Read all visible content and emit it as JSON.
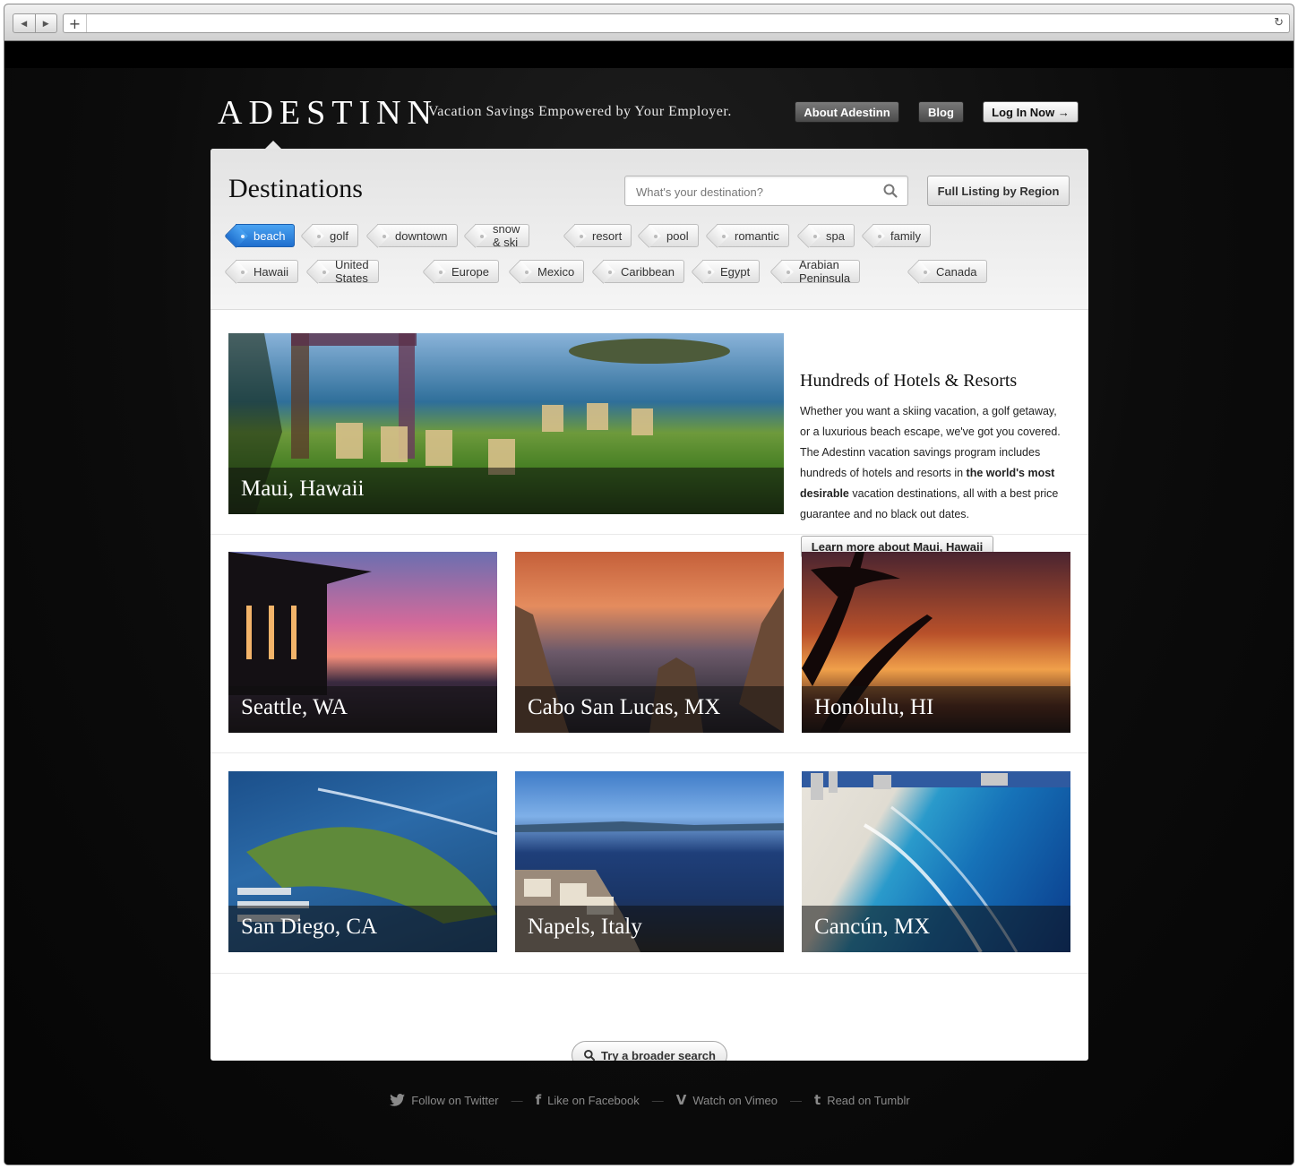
{
  "browser": {
    "back_glyph": "◀",
    "forward_glyph": "▶",
    "new_tab_glyph": "+",
    "reload_glyph": "↻",
    "address": ""
  },
  "header": {
    "logo": "ADESTINN",
    "tagline": "Vacation Savings Empowered by Your Employer.",
    "about_label": "About Adestinn",
    "blog_label": "Blog",
    "login_label": "Log In Now →"
  },
  "destinations": {
    "title": "Destinations",
    "search_placeholder": "What's your destination?",
    "full_listing_label": "Full Listing by Region",
    "tags_row1": [
      "beach",
      "golf",
      "downtown",
      "snow & ski",
      "resort",
      "pool",
      "romantic",
      "spa",
      "family"
    ],
    "tags_row2": [
      "Hawaii",
      "United States",
      "Europe",
      "Mexico",
      "Caribbean",
      "Egypt",
      "Arabian Peninsula",
      "Canada"
    ],
    "active_tag": "beach"
  },
  "featured": {
    "caption": "Maui, Hawaii",
    "heading": "Hundreds of Hotels & Resorts",
    "desc_1": "Whether you want a skiing vacation, a golf getaway, or a luxurious beach escape, we've got you covered. The Adestinn vacation savings program includes hundreds of hotels and resorts in ",
    "desc_bold": "the world's most desirable",
    "desc_2": " vacation destinations, all with a best price guarantee and no black out dates.",
    "learn_label": "Learn more about Maui, Hawaii"
  },
  "grid": [
    "Seattle, WA",
    "Cabo San Lucas, MX",
    "Honolulu, HI",
    "San Diego, CA",
    "Napels, Italy",
    "Cancún, MX"
  ],
  "broader_label": "Try a broader search",
  "footer": {
    "twitter": "Follow on Twitter",
    "facebook": "Like on Facebook",
    "vimeo": "Watch on Vimeo",
    "tumblr": "Read on Tumblr",
    "separator": "—"
  },
  "colors": {
    "accent_tag": "#2b82e0",
    "page_bg": "#0b0b0b"
  }
}
